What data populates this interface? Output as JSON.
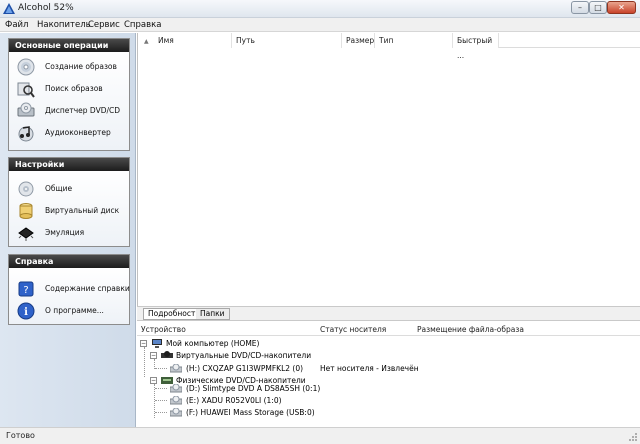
{
  "window": {
    "title": "Alcohol 52%"
  },
  "menu": [
    "Файл",
    "Накопитель",
    "Сервис",
    "Справка"
  ],
  "groups": [
    {
      "header": "Основные операции",
      "items": [
        {
          "label": "Создание образов",
          "icon": "disc-create-icon"
        },
        {
          "label": "Поиск образов",
          "icon": "search-images-icon"
        },
        {
          "label": "Диспетчер DVD/CD",
          "icon": "drive-manager-icon"
        },
        {
          "label": "Аудиоконвертер",
          "icon": "audio-converter-icon"
        }
      ]
    },
    {
      "header": "Настройки",
      "items": [
        {
          "label": "Общие",
          "icon": "general-settings-icon"
        },
        {
          "label": "Виртуальный диск",
          "icon": "virtual-disk-icon"
        },
        {
          "label": "Эмуляция",
          "icon": "emulation-chip-icon"
        }
      ]
    },
    {
      "header": "Справка",
      "items": [
        {
          "label": "Содержание справки",
          "icon": "help-book-icon"
        },
        {
          "label": "О программе...",
          "icon": "info-icon"
        }
      ]
    }
  ],
  "list": {
    "columns": [
      "Имя",
      "Путь",
      "Размер",
      "Тип",
      "Быстрый ..."
    ]
  },
  "tabs": [
    "Подробности",
    "Папки"
  ],
  "devices": {
    "columns": [
      "Устройство",
      "Статус носителя",
      "Размещение файла-образа"
    ],
    "root": "Мой компьютер (HOME)",
    "virtual_group": "Виртуальные DVD/CD-накопители",
    "virtual_drives": [
      {
        "name": "(H:) CXQZAP G1I3WPMFKL2 (0)",
        "status": "Нет носителя - Извлечён"
      }
    ],
    "physical_group": "Физические DVD/CD-накопители",
    "physical_drives": [
      {
        "name": "(D:) Slimtype DVD A  DS8A5SH (0:1)"
      },
      {
        "name": "(E:) XADU R052V0LI (1:0)"
      },
      {
        "name": "(F:) HUAWEI Mass Storage (USB:0)"
      }
    ]
  },
  "statusbar": {
    "text": "Готово"
  },
  "colors": {
    "group_header": "#2b2b2b",
    "panel_bg": "#d7e1ee",
    "close_button": "#c8432a"
  }
}
